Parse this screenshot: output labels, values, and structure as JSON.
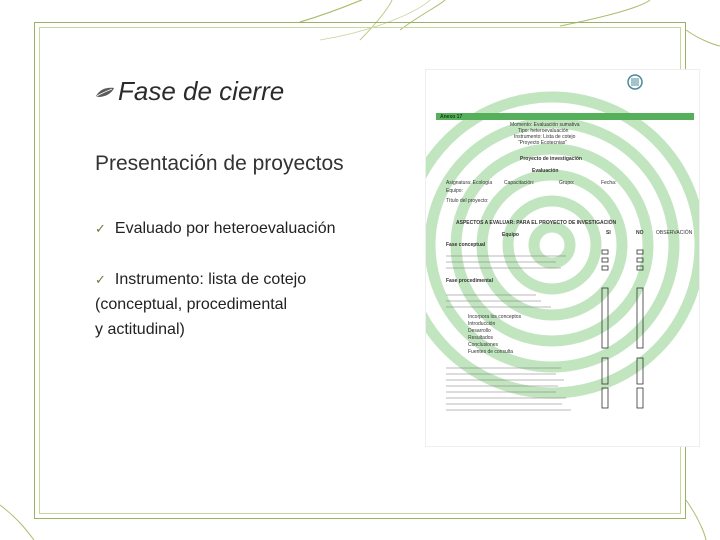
{
  "slide": {
    "heading": "Fase de cierre",
    "subtitle": "Presentación de proyectos",
    "bullets": [
      "Evaluado por heteroevaluación",
      "Instrumento:  lista de cotejo",
      "(conceptual, procedimental",
      "y actitudinal)"
    ],
    "icons": {
      "heading": "leaf-bullet-icon",
      "bullet": "checkmark-icon"
    },
    "colors": {
      "accent": "#9db06a",
      "swoosh": "#a9bf6d",
      "doc_green": "#56b05b"
    }
  },
  "document": {
    "annex": "Anexo 17",
    "header_lines": [
      "Momento: Evaluación sumativa",
      "Tipo: heteroevaluación",
      "Instrumento: Lista de cotejo",
      "“Proyecto Ecotecnias”"
    ],
    "section": "Proyecto de investigación",
    "evaluation": "Evaluación",
    "meta_fields": [
      "Asignatura: Ecología",
      "Capacitación:",
      "Grupo:",
      "Fecha:",
      "Equipo:",
      "Título del proyecto:"
    ],
    "table_header": "ASPECTOS A EVALUAR: PARA EL PROYECTO DE INVESTIGACIÓN",
    "col_team": "Equipo",
    "col_yes": "SI",
    "col_no": "NO",
    "col_obs": "OBSERVACIÓN",
    "groups": [
      "Fase conceptual",
      "Fase procedimental"
    ],
    "items": [
      "Incorpora los conceptos",
      "Introducción",
      "Desarrollo",
      "Resultados",
      "Conclusiones",
      "Fuentes de consulta"
    ]
  }
}
